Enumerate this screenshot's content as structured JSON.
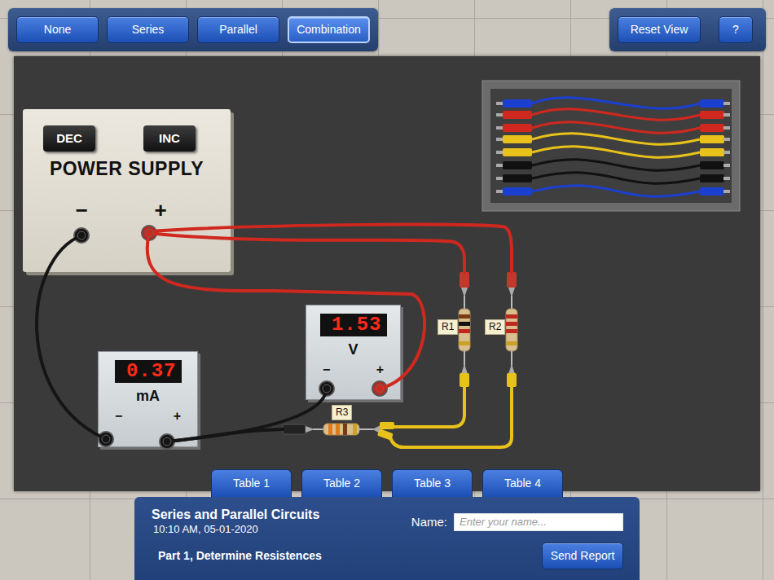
{
  "toolbar": {
    "modes": [
      {
        "label": "None",
        "selected": false
      },
      {
        "label": "Series",
        "selected": false
      },
      {
        "label": "Parallel",
        "selected": false
      },
      {
        "label": "Combination",
        "selected": true
      }
    ]
  },
  "view_controls": {
    "buttons": [
      "Reset View",
      "?"
    ]
  },
  "power_supply": {
    "title": "POWER SUPPLY",
    "buttons": [
      "DEC",
      "INC"
    ],
    "terminals": [
      "−",
      "+"
    ]
  },
  "voltmeter": {
    "reading": "1.53",
    "unit": "V",
    "terminals": [
      "−",
      "+"
    ]
  },
  "ammeter": {
    "reading": "0.37",
    "unit": "mA",
    "terminals": [
      "−",
      "+"
    ]
  },
  "resistors": [
    {
      "label": "R1",
      "bands": [
        "#7a3b12",
        "#111111",
        "#c0281e",
        "#c9a227"
      ]
    },
    {
      "label": "R2",
      "bands": [
        "#c0281e",
        "#c0281e",
        "#c0281e",
        "#c9a227"
      ]
    },
    {
      "label": "R3",
      "bands": [
        "#e07a1a",
        "#e07a1a",
        "#7a3b12",
        "#c9a227"
      ]
    }
  ],
  "tabs": [
    {
      "label": "Table 1",
      "selected": false
    },
    {
      "label": "Table 2",
      "selected": false
    },
    {
      "label": "Table 3",
      "selected": false
    },
    {
      "label": "Table 4",
      "selected": false
    }
  ],
  "report": {
    "title": "Series and Parallel Circuits",
    "timestamp": "10:10 AM, 05-01-2020",
    "name_label": "Name:",
    "name_placeholder": "Enter your name...",
    "section": "Part 1, Determine Resistences",
    "button": "Send Report"
  }
}
